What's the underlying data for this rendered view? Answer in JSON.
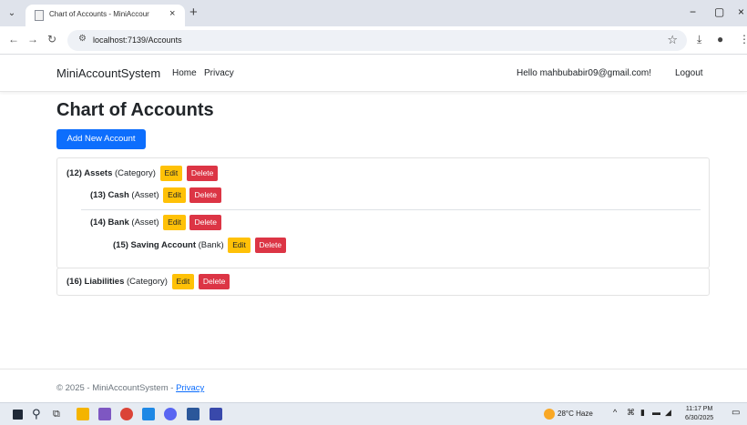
{
  "browser": {
    "tab_title": "Chart of Accounts - MiniAccour",
    "tab_close": "×",
    "new_tab": "+",
    "url": "localhost:7139/Accounts",
    "win_min": "−",
    "win_max": "▢",
    "win_close": "×"
  },
  "navbar": {
    "brand": "MiniAccountSystem",
    "links": [
      "Home",
      "Privacy"
    ],
    "greeting": "Hello mahbubabir09@gmail.com!",
    "logout": "Logout"
  },
  "main": {
    "title": "Chart of Accounts",
    "add_button": "Add New Account",
    "edit_label": "Edit",
    "delete_label": "Delete",
    "accounts": [
      {
        "id": "(12)",
        "name": "Assets",
        "type": "(Category)"
      },
      {
        "id": "(13)",
        "name": "Cash",
        "type": "(Asset)"
      },
      {
        "id": "(14)",
        "name": "Bank",
        "type": "(Asset)"
      },
      {
        "id": "(15)",
        "name": "Saving Account",
        "type": "(Bank)"
      },
      {
        "id": "(16)",
        "name": "Liabilities",
        "type": "(Category)"
      }
    ]
  },
  "footer": {
    "text": "© 2025 - MiniAccountSystem - ",
    "link": "Privacy"
  },
  "taskbar": {
    "weather": "28°C Haze",
    "time": "11:17 PM",
    "date": "6/30/2025"
  },
  "colors": {
    "primary": "#0d6efd",
    "warning": "#ffc107",
    "danger": "#dc3545"
  }
}
